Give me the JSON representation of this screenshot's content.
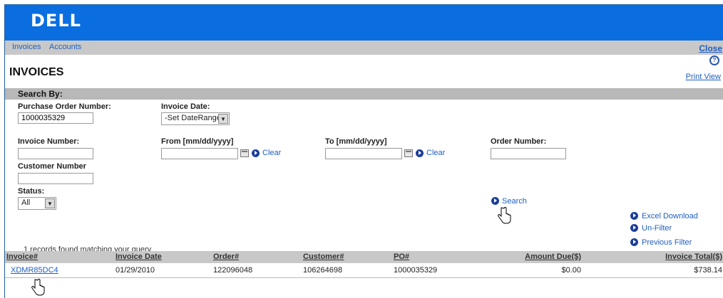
{
  "brand": {
    "logo": "DELL"
  },
  "nav": {
    "invoices": "Invoices",
    "accounts": "Accounts",
    "close": "Close",
    "help": "?"
  },
  "page": {
    "title": "INVOICES",
    "print": "Print View"
  },
  "search": {
    "header": "Search By:",
    "po_label": "Purchase Order Number:",
    "po_value": "1000035329",
    "inv_date_label": "Invoice Date:",
    "inv_date_value": "-Set DateRange-",
    "inv_num_label": "Invoice Number:",
    "from_label": "From [mm/dd/yyyy]",
    "to_label": "To [mm/dd/yyyy]",
    "order_label": "Order Number:",
    "clear": "Clear",
    "customer_label": "Customer Number",
    "status_label": "Status:",
    "status_value": "All",
    "search_button": "Search"
  },
  "actions": {
    "excel": "Excel Download",
    "unfilter": "Un-Filter",
    "previous": "Previous Filter"
  },
  "results": {
    "message": "1 records found matching your query.",
    "columns": [
      "Invoice#",
      "Invoice Date",
      "Order#",
      "Customer#",
      "PO#",
      "Amount Due($)",
      "Invoice Total($)"
    ],
    "rows": [
      [
        "XDMR85DC4",
        "01/29/2010",
        "122096048",
        "106264698",
        "1000035329",
        "$0.00",
        "$738.14"
      ]
    ]
  }
}
